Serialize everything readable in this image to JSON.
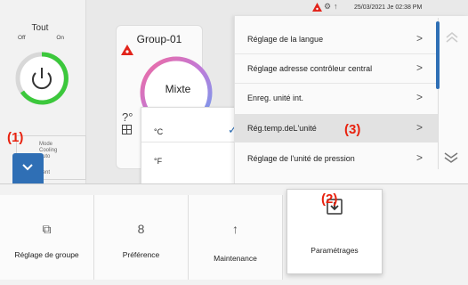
{
  "status_bar": {
    "datetime": "25/03/2021 Je 02:38 PM",
    "icons": [
      "warning-icon",
      "user-gear-icon",
      "maintenance-icon"
    ]
  },
  "power_panel": {
    "title": "Tout",
    "off_label": "Off",
    "on_label": "On",
    "accent_color": "#3cc83c"
  },
  "group_card": {
    "title": "Group-01",
    "mode": "Mixte"
  },
  "mode_tiles": {
    "lines": [
      "Mode",
      "Cooling",
      "Auto",
      "Vent"
    ]
  },
  "temperature_dropdown": {
    "options": [
      {
        "label": "°C",
        "selected": true
      },
      {
        "label": "°F",
        "selected": false
      }
    ]
  },
  "settings_menu": {
    "items": [
      {
        "label": "Réglage de la langue",
        "selected": false
      },
      {
        "label": "Réglage adresse contrôleur central",
        "selected": false
      },
      {
        "label": "Enreg. unité int.",
        "selected": false
      },
      {
        "label": "Rég.temp.deL'unité",
        "selected": true
      },
      {
        "label": "Réglage de l'unité de pression",
        "selected": false
      }
    ]
  },
  "callouts": {
    "one": "(1)",
    "two": "(2)",
    "three": "(3)",
    "color": "#e8220f"
  },
  "bottom_nav": {
    "tiles": [
      {
        "label": "Réglage de groupe",
        "icon": "group-settings-icon"
      },
      {
        "label": "Préférence",
        "icon": "person-icon"
      },
      {
        "label": "Maintenance",
        "icon": "maintenance-icon"
      },
      {
        "label": "Paramétrages",
        "icon": "download-box-icon"
      }
    ]
  },
  "accent_color": "#2f6fb5"
}
